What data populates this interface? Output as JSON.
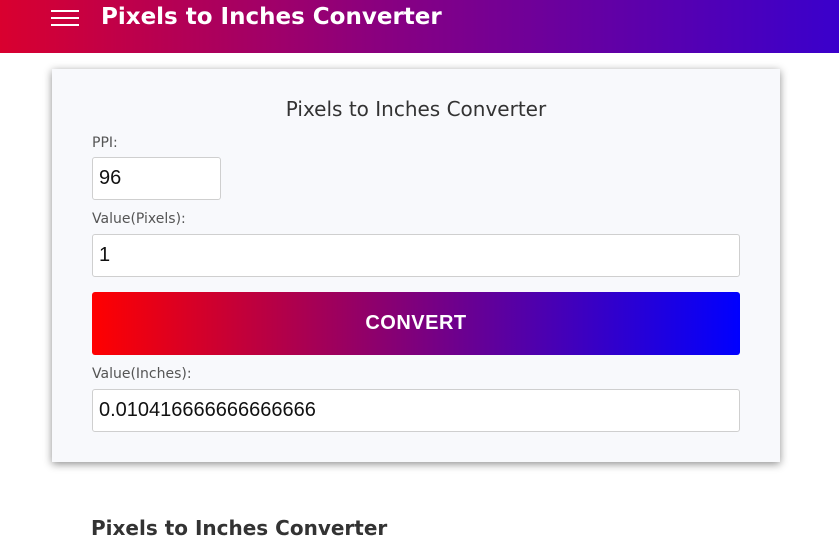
{
  "header": {
    "menu_icon": "hamburger-menu-icon",
    "title": "Pixels to Inches Converter",
    "gradient_colors": [
      "#d9002f",
      "#8a007f",
      "#3a00cc"
    ]
  },
  "converter": {
    "title": "Pixels to Inches Converter",
    "ppi_label": "PPI:",
    "ppi_value": "96",
    "pixels_label": "Value(Pixels):",
    "pixels_value": "1",
    "convert_label": "CONVERT",
    "convert_gradient": [
      "#ff0000",
      "#0000ff"
    ],
    "inches_label": "Value(Inches):",
    "inches_value": "0.010416666666666666"
  },
  "below": {
    "heading": "Pixels to Inches Converter"
  }
}
